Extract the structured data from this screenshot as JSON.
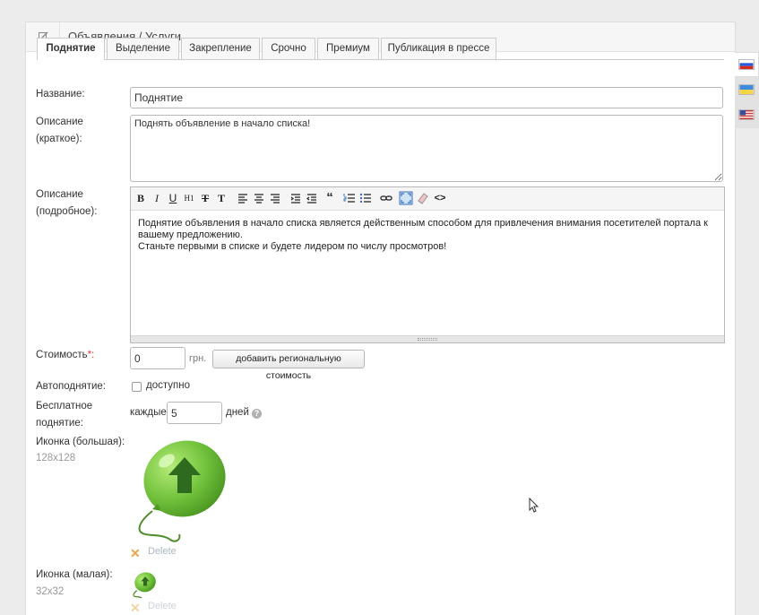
{
  "header": {
    "title": "Объявления / Услуги",
    "icon": "edit-icon"
  },
  "tabs": [
    {
      "label": "Поднятие",
      "active": true
    },
    {
      "label": "Выделение"
    },
    {
      "label": "Закрепление"
    },
    {
      "label": "Срочно"
    },
    {
      "label": "Премиум"
    },
    {
      "label": "Публикация в прессе"
    }
  ],
  "form": {
    "name_label": "Название:",
    "name_value": "Поднятие",
    "short_desc_label_1": "Описание",
    "short_desc_label_2": "(краткое):",
    "short_desc_value": "Поднять объявление в начало списка!",
    "full_desc_label_1": "Описание",
    "full_desc_label_2": "(подробное):",
    "full_desc_line_1": "Поднятие объявления в начало списка является действенным способом для привлечения внимания посетителей портала к вашему предложению.",
    "full_desc_line_2": "Станьте первыми в списке и будете лидером по числу просмотров!",
    "cost_label": "Стоимость",
    "cost_required": "*:",
    "cost_value": "0",
    "currency": "грн.",
    "regional_button": "добавить региональную стоимость",
    "autoraise_label": "Автоподнятие:",
    "autoraise_option": "доступно",
    "free_label_1": "Бесплатное",
    "free_label_2": "поднятие:",
    "free_every": "каждые",
    "free_value": "5",
    "free_days": "дней",
    "icon_big_label": "Иконка (большая):",
    "icon_big_size": "128x128",
    "icon_small_label": "Иконка (малая):",
    "icon_small_size": "32x32",
    "delete_label": "Delete",
    "help_symbol": "?"
  },
  "toolbar": {
    "bold": "B",
    "italic": "I",
    "underline": "U",
    "heading": "H1",
    "clear_format": "T",
    "text_color": "T",
    "quote": "“",
    "code": "<>"
  },
  "languages": [
    "ru",
    "uk",
    "en"
  ],
  "colors": {
    "tab_border": "#cccccc",
    "balloon": "#7cc84a",
    "arrow": "#2f6b1f",
    "delete": "#aab6c0"
  }
}
